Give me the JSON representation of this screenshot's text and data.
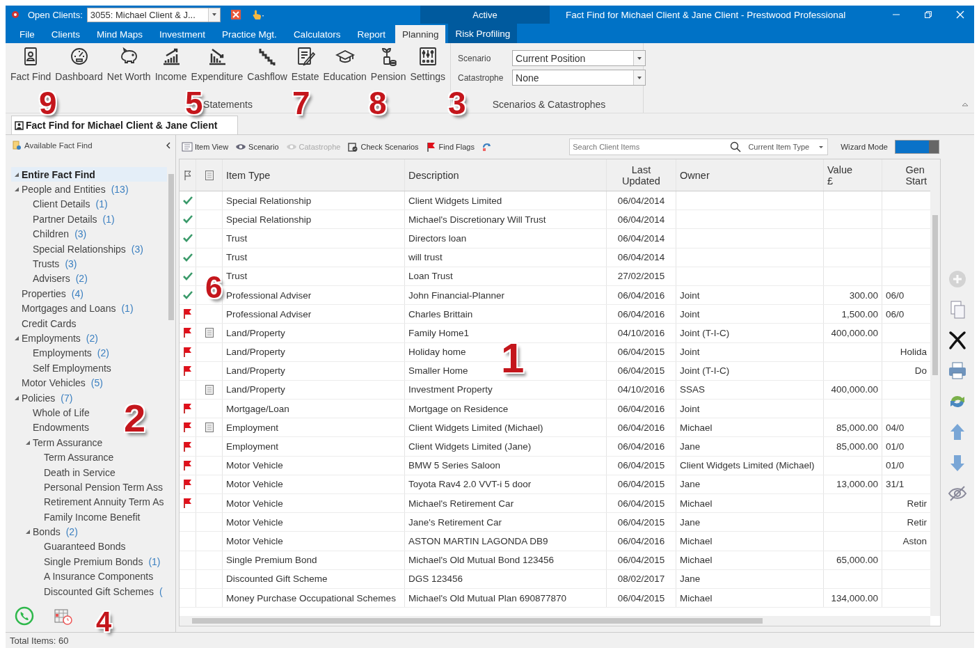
{
  "title_bar": {
    "open_clients_label": "Open Clients:",
    "client_combo": "3055: Michael Client & J...",
    "context_tab": "Active",
    "title": "Fact Find for Michael Client & Jane Client - Prestwood Professional"
  },
  "menu_tabs": [
    {
      "label": "File",
      "selected": false
    },
    {
      "label": "Clients",
      "selected": false
    },
    {
      "label": "Mind Maps",
      "selected": false
    },
    {
      "label": "Investment",
      "selected": false
    },
    {
      "label": "Practice Mgt.",
      "selected": false
    },
    {
      "label": "Calculators",
      "selected": false
    },
    {
      "label": "Report",
      "selected": false
    },
    {
      "label": "Planning",
      "selected": true
    },
    {
      "label": "Risk Profiling",
      "selected": false
    }
  ],
  "ribbon": {
    "buttons": [
      "Fact Find",
      "Dashboard",
      "Net Worth",
      "Income",
      "Expenditure",
      "Cashflow",
      "Estate",
      "Education",
      "Pension",
      "Settings"
    ],
    "group_label": "Statements",
    "scenario_label": "Scenario",
    "scenario_value": "Current Position",
    "catastrophe_label": "Catastrophe",
    "catastrophe_value": "None",
    "scenarios_group_label": "Scenarios & Catastrophes"
  },
  "document_tab": "Fact Find for Michael Client & Jane Client",
  "sidebar": {
    "title": "Available Fact Find",
    "tree": [
      {
        "label": "Entire Fact Find",
        "expanded": true,
        "selected": true
      },
      {
        "label": "People and Entities",
        "count": "(13)",
        "expanded": true,
        "selected": false,
        "children": [
          {
            "label": "Client Details",
            "count": "(1)",
            "selected": false
          },
          {
            "label": "Partner Details",
            "count": "(1)",
            "selected": false
          },
          {
            "label": "Children",
            "count": "(3)",
            "selected": false
          },
          {
            "label": "Special Relationships",
            "count": "(3)",
            "selected": false
          },
          {
            "label": "Trusts",
            "count": "(3)",
            "selected": false
          },
          {
            "label": "Advisers",
            "count": "(2)",
            "selected": false
          }
        ]
      },
      {
        "label": "Properties",
        "count": "(4)",
        "selected": false
      },
      {
        "label": "Mortgages and Loans",
        "count": "(1)",
        "selected": false
      },
      {
        "label": "Credit Cards",
        "selected": false
      },
      {
        "label": "Employments",
        "count": "(2)",
        "expanded": true,
        "selected": false,
        "children": [
          {
            "label": "Employments",
            "count": "(2)",
            "selected": false
          },
          {
            "label": "Self Employments",
            "selected": false
          }
        ]
      },
      {
        "label": "Motor Vehicles",
        "count": "(5)",
        "selected": false
      },
      {
        "label": "Policies",
        "count": "(7)",
        "expanded": true,
        "selected": false,
        "children": [
          {
            "label": "Whole of Life",
            "selected": false
          },
          {
            "label": "Endowments",
            "selected": false
          },
          {
            "label": "Term Assurance",
            "expanded": true,
            "selected": false,
            "children": [
              {
                "label": "Term Assurance",
                "selected": false
              },
              {
                "label": "Death in Service",
                "selected": false
              },
              {
                "label": "Personal Pension Term Ass",
                "selected": false
              },
              {
                "label": "Retirement Annuity Term As",
                "selected": false
              },
              {
                "label": "Family Income Benefit",
                "selected": false
              }
            ]
          },
          {
            "label": "Bonds",
            "count": "(2)",
            "expanded": true,
            "selected": false,
            "children": [
              {
                "label": "Guaranteed Bonds",
                "selected": false
              },
              {
                "label": "Single Premium Bonds",
                "count": "(1)",
                "selected": false
              },
              {
                "label": "A Insurance Components",
                "selected": false
              },
              {
                "label": "Discounted Gift Schemes",
                "count": "(",
                "selected": false
              }
            ]
          }
        ]
      }
    ]
  },
  "toolbar": {
    "buttons": [
      {
        "label": "Item View",
        "disabled": false
      },
      {
        "label": "Scenario",
        "disabled": false
      },
      {
        "label": "Catastrophe",
        "disabled": true
      },
      {
        "label": "Check Scenarios",
        "disabled": false
      },
      {
        "label": "Find Flags",
        "disabled": false
      }
    ],
    "search_placeholder": "Search Client Items",
    "filter": "Current Item Type",
    "wizard_label": "Wizard Mode",
    "wizard_on": true
  },
  "table": {
    "columns": [
      [
        "Item Type"
      ],
      [
        "Description"
      ],
      [
        "Last",
        "Updated"
      ],
      [
        "Owner"
      ],
      [
        "Value",
        "£"
      ],
      [
        "Gen",
        "Start"
      ]
    ],
    "rows": [
      {
        "checked": true,
        "flagged": false,
        "has_document": false,
        "item_type": "Special Relationship",
        "description": "Client Widgets Limited",
        "last_updated": "06/04/2014"
      },
      {
        "checked": true,
        "flagged": false,
        "has_document": false,
        "item_type": "Special Relationship",
        "description": "Michael's Discretionary Will Trust",
        "last_updated": "06/04/2014"
      },
      {
        "checked": true,
        "flagged": false,
        "has_document": false,
        "item_type": "Trust",
        "description": "Directors loan",
        "last_updated": "06/04/2014"
      },
      {
        "checked": true,
        "flagged": false,
        "has_document": false,
        "item_type": "Trust",
        "description": "will trust",
        "last_updated": "06/04/2014"
      },
      {
        "checked": true,
        "flagged": false,
        "has_document": false,
        "item_type": "Trust",
        "description": "Loan Trust",
        "last_updated": "27/02/2015"
      },
      {
        "checked": true,
        "flagged": false,
        "has_document": false,
        "item_type": "Professional Adviser",
        "description": "John Financial-Planner",
        "last_updated": "06/04/2016",
        "owner": "Joint",
        "value": "300.00",
        "column_6": "06/0"
      },
      {
        "checked": false,
        "flagged": true,
        "has_document": false,
        "item_type": "Professional Adviser",
        "description": "Charles Brittain",
        "last_updated": "06/04/2016",
        "owner": "Joint",
        "value": "1,500.00",
        "column_6": "06/0"
      },
      {
        "checked": false,
        "flagged": true,
        "has_document": true,
        "item_type": "Land/Property",
        "description": "Family Home1",
        "last_updated": "04/10/2016",
        "owner": "Joint (T-I-C)",
        "value": "400,000.00"
      },
      {
        "checked": false,
        "flagged": true,
        "has_document": false,
        "item_type": "Land/Property",
        "description": "Holiday home",
        "last_updated": "06/04/2015",
        "owner": "Joint",
        "column_6": "Holida"
      },
      {
        "checked": false,
        "flagged": true,
        "has_document": false,
        "item_type": "Land/Property",
        "description": "Smaller Home",
        "last_updated": "06/04/2015",
        "owner": "Joint (T-I-C)",
        "column_6": "Do"
      },
      {
        "checked": false,
        "flagged": false,
        "has_document": true,
        "item_type": "Land/Property",
        "description": "Investment Property",
        "last_updated": "04/10/2016",
        "owner": "SSAS",
        "value": "400,000.00"
      },
      {
        "checked": false,
        "flagged": true,
        "has_document": false,
        "item_type": "Mortgage/Loan",
        "description": "Mortgage on Residence",
        "last_updated": "06/04/2016",
        "owner": "Joint"
      },
      {
        "checked": false,
        "flagged": true,
        "has_document": true,
        "item_type": "Employment",
        "description": "Client Widgets Limited (Michael)",
        "last_updated": "06/04/2016",
        "owner": "Michael",
        "value": "85,000.00",
        "column_6": "04/0"
      },
      {
        "checked": false,
        "flagged": true,
        "has_document": false,
        "item_type": "Employment",
        "description": "Client Widgets Limited (Jane)",
        "last_updated": "06/04/2016",
        "owner": "Jane",
        "value": "85,000.00",
        "column_6": "01/0"
      },
      {
        "checked": false,
        "flagged": true,
        "has_document": false,
        "item_type": "Motor Vehicle",
        "description": "BMW 5 Series Saloon",
        "last_updated": "06/04/2015",
        "owner": "Client Widgets Limited (Michael)",
        "column_6": "01/0"
      },
      {
        "checked": false,
        "flagged": true,
        "has_document": false,
        "item_type": "Motor Vehicle",
        "description": "Toyota Rav4 2.0 VVT-i 5 door",
        "last_updated": "06/04/2015",
        "owner": "Jane",
        "value": "13,000.00",
        "column_6": "31/1"
      },
      {
        "checked": false,
        "flagged": true,
        "has_document": false,
        "item_type": "Motor Vehicle",
        "description": "Michael's Retirement Car",
        "last_updated": "06/04/2015",
        "owner": "Michael",
        "column_6": "Retir"
      },
      {
        "checked": false,
        "flagged": false,
        "has_document": false,
        "item_type": "Motor Vehicle",
        "description": "Jane's Retirement Car",
        "last_updated": "06/04/2015",
        "owner": "Jane",
        "column_6": "Retir"
      },
      {
        "checked": false,
        "flagged": false,
        "has_document": false,
        "item_type": "Motor Vehicle",
        "description": "ASTON MARTIN LAGONDA DB9",
        "last_updated": "06/04/2016",
        "owner": "Michael",
        "column_6": "Aston"
      },
      {
        "checked": false,
        "flagged": false,
        "has_document": false,
        "item_type": "Single Premium Bond",
        "description": "Michael's Old Mutual Bond 123456",
        "last_updated": "06/04/2015",
        "owner": "Michael",
        "value": "65,000.00"
      },
      {
        "checked": false,
        "flagged": false,
        "has_document": false,
        "item_type": "Discounted Gift Scheme",
        "description": "DGS 123456",
        "last_updated": "08/02/2017",
        "owner": "Jane"
      },
      {
        "checked": false,
        "flagged": false,
        "has_document": false,
        "item_type": "Money Purchase Occupational Schemes",
        "description": "Michael's Old Mutual Plan 690877870",
        "last_updated": "06/04/2015",
        "owner": "Michael",
        "value": "134,000.00"
      }
    ]
  },
  "side_actions": [
    {
      "disabled": true
    },
    {
      "disabled": false
    },
    {
      "disabled": false
    },
    {
      "disabled": false
    },
    {
      "disabled": false
    },
    {
      "disabled": false
    },
    {
      "disabled": false
    },
    {
      "disabled": false
    }
  ],
  "status_bar": "Total Items: 60",
  "callouts": [
    "9",
    "5",
    "7",
    "8",
    "3",
    "6",
    "1",
    "2",
    "4"
  ]
}
